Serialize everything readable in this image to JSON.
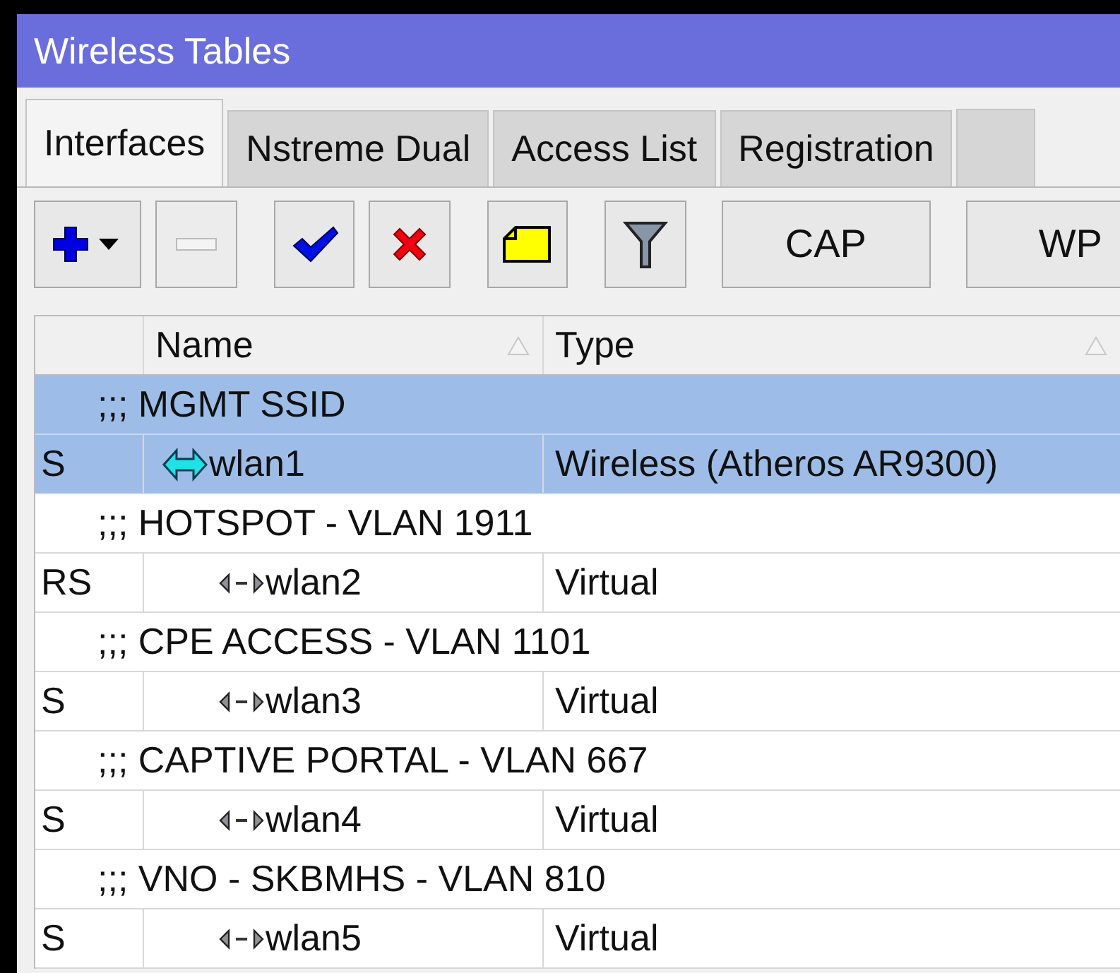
{
  "window": {
    "title": "Wireless Tables"
  },
  "tabs": [
    {
      "label": "Interfaces",
      "selected": true
    },
    {
      "label": "Nstreme Dual",
      "selected": false
    },
    {
      "label": "Access List",
      "selected": false
    },
    {
      "label": "Registration",
      "selected": false
    }
  ],
  "toolbar": [
    {
      "kind": "add"
    },
    {
      "kind": "remove",
      "disabled": true
    },
    {
      "kind": "enable"
    },
    {
      "kind": "disable"
    },
    {
      "kind": "comment"
    },
    {
      "kind": "filter"
    },
    {
      "kind": "text",
      "label": "CAP"
    },
    {
      "kind": "text",
      "label": "WP"
    }
  ],
  "table": {
    "columns": [
      "Name",
      "Type"
    ],
    "rows": [
      {
        "kind": "comment",
        "text": ";;; MGMT SSID",
        "selected": true
      },
      {
        "kind": "wireless",
        "flags": "S",
        "name": "wlan1",
        "type": "Wireless (Atheros AR9300)",
        "selected": true
      },
      {
        "kind": "comment",
        "text": ";;; HOTSPOT - VLAN 1911",
        "selected": false
      },
      {
        "kind": "virtual",
        "flags": "RS",
        "name": "wlan2",
        "type": "Virtual",
        "selected": false
      },
      {
        "kind": "comment",
        "text": ";;; CPE ACCESS - VLAN 1101",
        "selected": false
      },
      {
        "kind": "virtual",
        "flags": "S",
        "name": "wlan3",
        "type": "Virtual",
        "selected": false
      },
      {
        "kind": "comment",
        "text": ";;; CAPTIVE PORTAL - VLAN 667",
        "selected": false
      },
      {
        "kind": "virtual",
        "flags": "S",
        "name": "wlan4",
        "type": "Virtual",
        "selected": false
      },
      {
        "kind": "comment",
        "text": ";;; VNO - SKBMHS - VLAN 810",
        "selected": false
      },
      {
        "kind": "virtual",
        "flags": "S",
        "name": "wlan5",
        "type": "Virtual",
        "selected": false
      }
    ]
  }
}
